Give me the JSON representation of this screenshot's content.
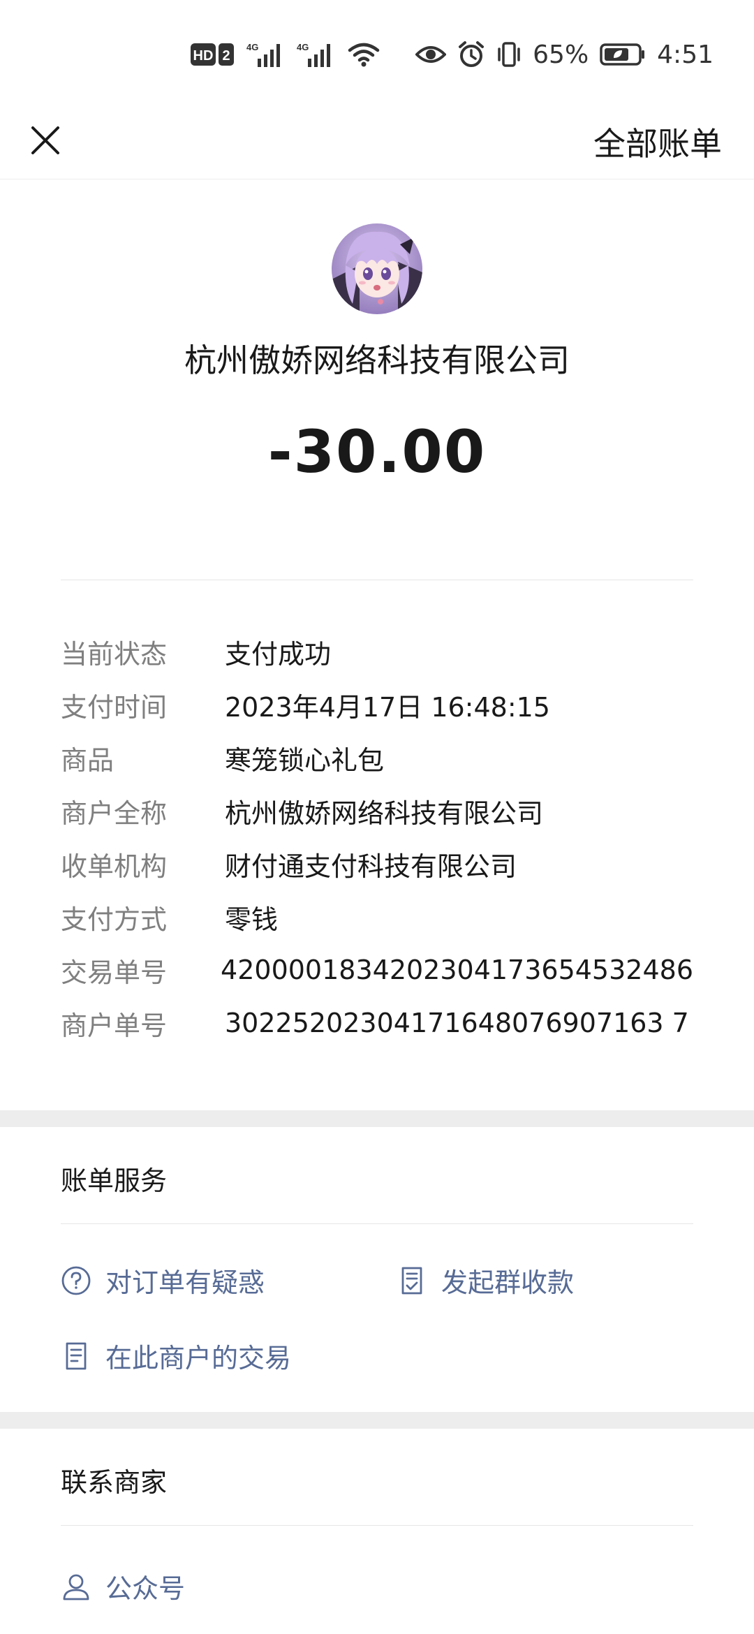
{
  "status_bar": {
    "battery": "65%",
    "time": "4:51",
    "network_1": "4G",
    "network_2": "4G",
    "hd_label": "HD",
    "sim_label": "2"
  },
  "nav": {
    "all_bills_label": "全部账单"
  },
  "header": {
    "merchant_name": "杭州傲娇网络科技有限公司",
    "amount": "-30.00"
  },
  "details": [
    {
      "label": "当前状态",
      "value": "支付成功"
    },
    {
      "label": "支付时间",
      "value": "2023年4月17日 16:48:15"
    },
    {
      "label": "商品",
      "value": "寒笼锁心礼包"
    },
    {
      "label": "商户全称",
      "value": "杭州傲娇网络科技有限公司"
    },
    {
      "label": "收单机构",
      "value": "财付通支付科技有限公司"
    },
    {
      "label": "支付方式",
      "value": "零钱"
    },
    {
      "label": "交易单号",
      "value": "4200001834202304173654532486"
    },
    {
      "label": "商户单号",
      "value": "30225202304171648076907163 7"
    }
  ],
  "bill_service": {
    "title": "账单服务",
    "links": {
      "order_question": "对订单有疑惑",
      "group_collect": "发起群收款",
      "merchant_transactions": "在此商户的交易"
    }
  },
  "contact_merchant": {
    "title": "联系商家",
    "official_account": "公众号"
  },
  "colors": {
    "link": "#576b95",
    "label": "#7f7f7f",
    "text": "#191919",
    "separator": "#ededed"
  }
}
